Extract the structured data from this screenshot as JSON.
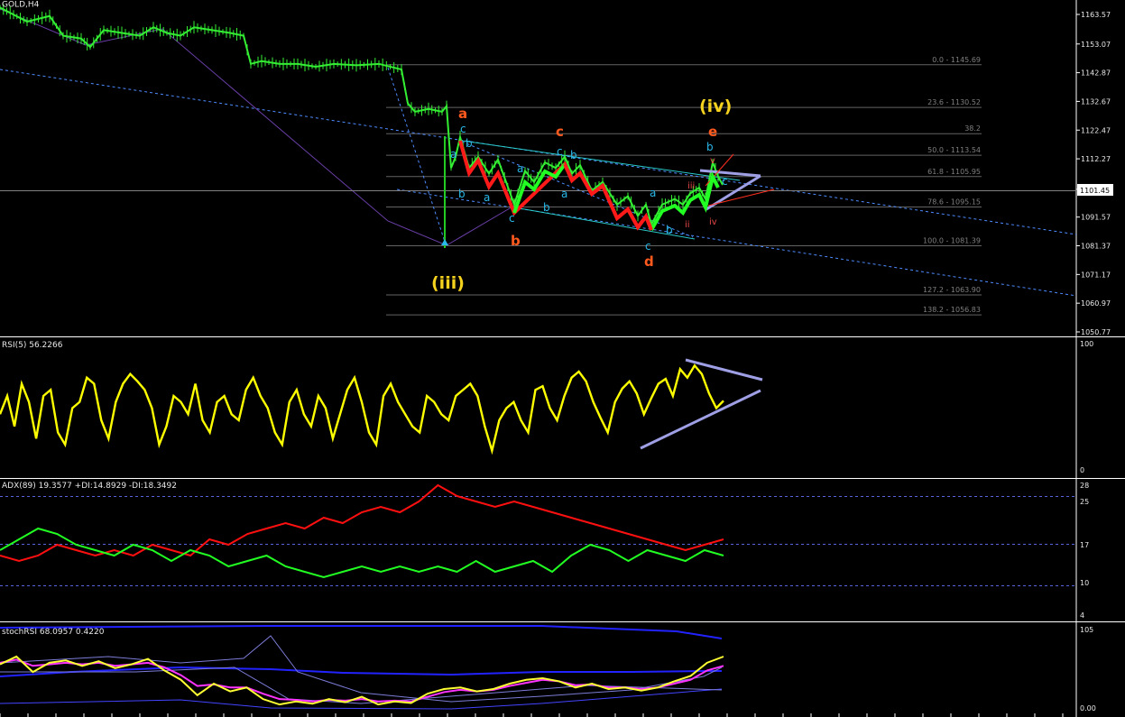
{
  "colors": {
    "background": "#000000",
    "axis": "#ffffff",
    "price": "#33ee33",
    "bear_leg": "#ff1a1a",
    "bull_leg": "#22ff22",
    "channel": "#29c9c9",
    "dotted_trend": "#4d8cff",
    "purple_line": "#6a3fa8",
    "triangle": "#9f9fe6",
    "fib": "#636363",
    "rsi": "#ffff00",
    "adx_red": "#ff1010",
    "adx_green": "#22ff22",
    "stoch_yellow": "#ffff33",
    "stoch_magenta": "#ff33ff",
    "stoch_blue": "#2222ff",
    "wave_yellow": "#f5d21e",
    "wave_orange": "#ff5a1e",
    "wave_cyan": "#29b8e8",
    "wave_red": "#e84646"
  },
  "header": {
    "main": "GOLD,H4",
    "rsi": "RSI(5) 56.2266",
    "adx": "ADX(89) 19.3577  +DI:14.8929  -DI:18.3492",
    "stoch": "stochRSI 68.0957  0.4220"
  },
  "chart_data": [
    {
      "type": "candlestick",
      "title": "GOLD,H4",
      "y_ticks": [
        "1163.57",
        "1153.07",
        "1142.87",
        "1132.67",
        "1122.47",
        "1112.27",
        "1101.45",
        "1091.57",
        "1081.37",
        "1071.17",
        "1060.97",
        "1050.77"
      ],
      "current_price": "1101.45",
      "ylim": [
        1048,
        1168
      ],
      "price_path": [
        [
          0,
          1166
        ],
        [
          30,
          1161
        ],
        [
          55,
          1163
        ],
        [
          70,
          1156
        ],
        [
          90,
          1155
        ],
        [
          100,
          1152
        ],
        [
          115,
          1158
        ],
        [
          135,
          1157
        ],
        [
          155,
          1156
        ],
        [
          170,
          1159
        ],
        [
          185,
          1157
        ],
        [
          200,
          1156
        ],
        [
          215,
          1159
        ],
        [
          235,
          1158
        ],
        [
          255,
          1157
        ],
        [
          270,
          1156
        ],
        [
          278,
          1146
        ],
        [
          290,
          1147
        ],
        [
          310,
          1146
        ],
        [
          330,
          1146
        ],
        [
          350,
          1145
        ],
        [
          370,
          1146
        ],
        [
          395,
          1145.5
        ],
        [
          420,
          1146
        ],
        [
          445,
          1144
        ],
        [
          452,
          1132
        ],
        [
          460,
          1129
        ],
        [
          475,
          1130
        ],
        [
          490,
          1129
        ],
        [
          495,
          1131
        ],
        [
          500,
          1109
        ],
        [
          505,
          1113
        ],
        [
          510,
          1120
        ],
        [
          520,
          1109
        ],
        [
          530,
          1113
        ],
        [
          542,
          1107
        ],
        [
          552,
          1112
        ],
        [
          570,
          1096
        ],
        [
          582,
          1108
        ],
        [
          592,
          1104
        ],
        [
          604,
          1111
        ],
        [
          616,
          1109
        ],
        [
          626,
          1113
        ],
        [
          634,
          1107
        ],
        [
          643,
          1110
        ],
        [
          656,
          1101
        ],
        [
          668,
          1104
        ],
        [
          684,
          1096
        ],
        [
          696,
          1099
        ],
        [
          707,
          1092
        ],
        [
          716,
          1096
        ],
        [
          722,
          1089
        ],
        [
          734,
          1096
        ],
        [
          748,
          1098
        ],
        [
          757,
          1096
        ],
        [
          765,
          1100
        ],
        [
          775,
          1102
        ],
        [
          782,
          1098
        ],
        [
          790,
          1111
        ],
        [
          796,
          1106
        ],
        [
          801,
          1103
        ]
      ],
      "fibonacci": [
        {
          "label": "0.0 - 1145.69",
          "price": 1145.69
        },
        {
          "label": "23.6 - 1130.52",
          "price": 1130.52
        },
        {
          "label": "38.2",
          "price": 1121.2
        },
        {
          "label": "50.0 - 1113.54",
          "price": 1113.54
        },
        {
          "label": "61.8 - 1105.95",
          "price": 1105.95
        },
        {
          "label": "78.6 - 1095.15",
          "price": 1095.15
        },
        {
          "label": "100.0 - 1081.39",
          "price": 1081.39
        },
        {
          "label": "127.2 - 1063.90",
          "price": 1063.9
        },
        {
          "label": "138.2 - 1056.83",
          "price": 1056.83
        }
      ],
      "wave_labels": [
        {
          "text": "(iii)",
          "color": "wave_yellow",
          "size": "big"
        },
        {
          "text": "(iv)",
          "color": "wave_yellow",
          "size": "big"
        },
        {
          "text": "a",
          "color": "wave_orange",
          "size": "mid"
        },
        {
          "text": "b",
          "color": "wave_orange",
          "size": "mid"
        },
        {
          "text": "c",
          "color": "wave_orange",
          "size": "mid"
        },
        {
          "text": "d",
          "color": "wave_orange",
          "size": "mid"
        },
        {
          "text": "e",
          "color": "wave_orange",
          "size": "mid"
        },
        {
          "text": "c",
          "color": "wave_cyan",
          "size": "small"
        },
        {
          "text": "a",
          "color": "wave_cyan",
          "size": "small"
        },
        {
          "text": "b",
          "color": "wave_cyan",
          "size": "small"
        },
        {
          "text": "a",
          "color": "wave_cyan",
          "size": "small"
        },
        {
          "text": "c",
          "color": "wave_cyan",
          "size": "small"
        },
        {
          "text": "b",
          "color": "wave_cyan",
          "size": "small"
        },
        {
          "text": "a",
          "color": "wave_cyan",
          "size": "small"
        },
        {
          "text": "c",
          "color": "wave_cyan",
          "size": "small"
        },
        {
          "text": "b",
          "color": "wave_cyan",
          "size": "small"
        },
        {
          "text": "a",
          "color": "wave_cyan",
          "size": "small"
        },
        {
          "text": "b",
          "color": "wave_cyan",
          "size": "small"
        },
        {
          "text": "a",
          "color": "wave_cyan",
          "size": "small"
        },
        {
          "text": "b",
          "color": "wave_cyan",
          "size": "small"
        },
        {
          "text": "c",
          "color": "wave_cyan",
          "size": "small"
        },
        {
          "text": "b",
          "color": "wave_cyan",
          "size": "small"
        },
        {
          "text": "c",
          "color": "wave_cyan",
          "size": "small"
        },
        {
          "text": "iii",
          "color": "wave_red",
          "size": "tiny"
        },
        {
          "text": "ii",
          "color": "wave_red",
          "size": "tiny"
        },
        {
          "text": "v",
          "color": "wave_red",
          "size": "tiny"
        },
        {
          "text": "iv",
          "color": "wave_red",
          "size": "tiny"
        }
      ]
    },
    {
      "type": "line",
      "title": "RSI(5) 56.2266",
      "y_ticks": [
        "100",
        "0"
      ],
      "ylim": [
        0,
        100
      ],
      "series": [
        {
          "color": "rsi",
          "values": [
            45,
            60,
            35,
            70,
            55,
            25,
            60,
            65,
            30,
            20,
            50,
            55,
            75,
            70,
            40,
            25,
            55,
            70,
            78,
            72,
            65,
            50,
            20,
            35,
            60,
            55,
            45,
            70,
            40,
            30,
            55,
            60,
            45,
            40,
            65,
            75,
            60,
            50,
            30,
            20,
            55,
            65,
            45,
            35,
            60,
            50,
            25,
            45,
            65,
            75,
            55,
            30,
            20,
            60,
            70,
            55,
            45,
            35,
            30,
            60,
            55,
            45,
            40,
            60,
            65,
            70,
            60,
            35,
            15,
            40,
            50,
            55,
            40,
            30,
            65,
            68,
            50,
            40,
            60,
            75,
            80,
            72,
            55,
            42,
            30,
            55,
            66,
            72,
            62,
            45,
            58,
            70,
            74,
            60,
            82,
            75,
            85,
            78,
            62,
            50,
            56
          ]
        }
      ]
    },
    {
      "type": "line",
      "title": "ADX(89) 19.3577  +DI:14.8929  -DI:18.3492",
      "y_ticks": [
        "28",
        "25",
        "17",
        "10",
        "4"
      ],
      "ylim": [
        4,
        28
      ],
      "series": [
        {
          "name": "+DI",
          "color": "adx_green",
          "values": [
            16,
            18,
            20,
            19,
            17,
            16,
            15,
            17,
            16,
            14,
            16,
            15,
            13,
            14,
            15,
            13,
            12,
            11,
            12,
            13,
            12,
            13,
            12,
            13,
            12,
            14,
            12,
            13,
            14,
            12,
            15,
            17,
            16,
            14,
            16,
            15,
            14,
            16,
            15
          ]
        },
        {
          "name": "-DI",
          "color": "adx_red",
          "values": [
            15,
            14,
            15,
            17,
            16,
            15,
            16,
            15,
            17,
            16,
            15,
            18,
            17,
            19,
            20,
            21,
            20,
            22,
            21,
            23,
            24,
            23,
            25,
            28,
            26,
            25,
            24,
            25,
            24,
            23,
            22,
            21,
            20,
            19,
            18,
            17,
            16,
            17,
            18
          ]
        }
      ]
    },
    {
      "type": "line",
      "title": "stochRSI 68.0957  0.4220",
      "y_ticks": [
        "105",
        "0.00"
      ],
      "ylim": [
        0,
        105
      ],
      "series": [
        {
          "color": "stoch_yellow",
          "values": [
            60,
            70,
            50,
            62,
            65,
            58,
            64,
            55,
            60,
            67,
            52,
            40,
            20,
            35,
            25,
            30,
            15,
            8,
            12,
            9,
            15,
            11,
            18,
            8,
            12,
            10,
            22,
            28,
            30,
            25,
            28,
            35,
            40,
            42,
            38,
            30,
            35,
            28,
            30,
            26,
            30,
            38,
            45,
            62,
            70
          ]
        },
        {
          "color": "stoch_magenta",
          "values": [
            62,
            66,
            58,
            60,
            62,
            60,
            62,
            58,
            60,
            62,
            56,
            46,
            32,
            34,
            30,
            30,
            22,
            15,
            14,
            12,
            14,
            13,
            15,
            12,
            13,
            12,
            18,
            24,
            27,
            25,
            27,
            32,
            36,
            40,
            38,
            33,
            34,
            30,
            30,
            28,
            30,
            35,
            40,
            52,
            58
          ]
        }
      ]
    }
  ]
}
